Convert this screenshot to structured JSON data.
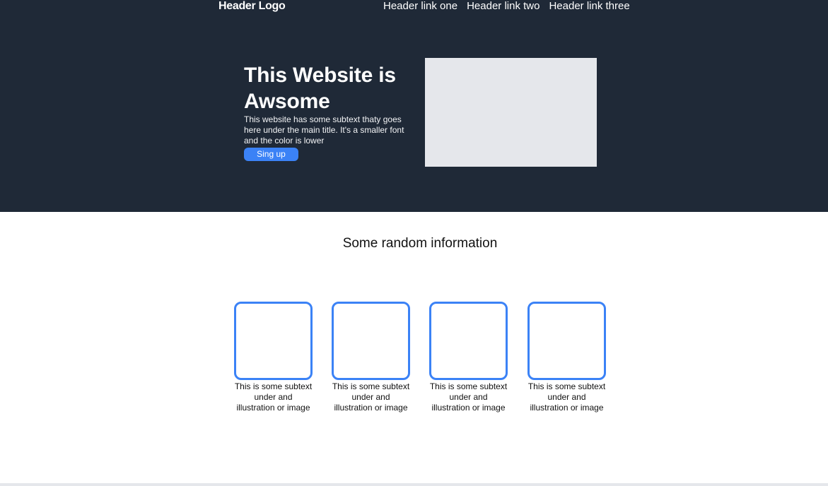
{
  "header": {
    "logo": "Header Logo",
    "links": [
      "Header link one",
      "Header link two",
      "Header link three"
    ]
  },
  "hero": {
    "title": "This Website is Awsome",
    "subtext": "This website has some subtext thaty goes here under the main title. It's a smaller font and the color is lower",
    "button_label": "Sing up"
  },
  "info": {
    "title": "Some random information",
    "items": [
      "This is some subtext under and illustration or image",
      "This is some subtext under and illustration or image",
      "This is some subtext under and illustration or image",
      "This is some subtext under and illustration or image"
    ]
  },
  "colors": {
    "hero_background": "#1f2937",
    "accent": "#3b82f6",
    "placeholder": "#e5e7eb"
  }
}
